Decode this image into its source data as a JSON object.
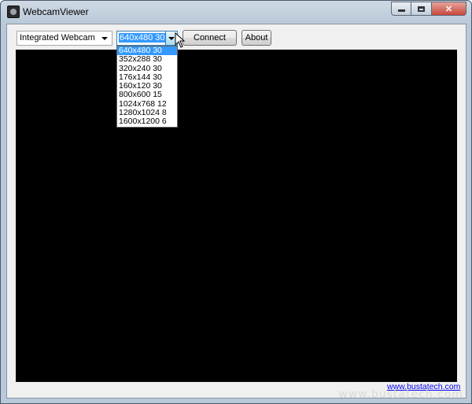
{
  "window": {
    "title": "WebcamViewer",
    "controls": {
      "minimize_icon": "minimize-icon",
      "maximize_icon": "maximize-icon",
      "close_label": "✕"
    }
  },
  "toolbar": {
    "camera_select": {
      "value": "Integrated Webcam"
    },
    "resolution_select": {
      "value": "640x480 30",
      "options": [
        "640x480 30",
        "352x288 30",
        "320x240 30",
        "176x144 30",
        "160x120 30",
        "800x600 15",
        "1024x768 12",
        "1280x1024 8",
        "1600x1200 6"
      ],
      "selected_index": 0
    },
    "connect_label": "Connect",
    "about_label": "About"
  },
  "footer": {
    "link_text": "www.bustatech.com"
  },
  "watermark": "www.bustatech.com",
  "colors": {
    "video_bg": "#000000",
    "selection": "#3399ff",
    "link": "#0000ee"
  }
}
